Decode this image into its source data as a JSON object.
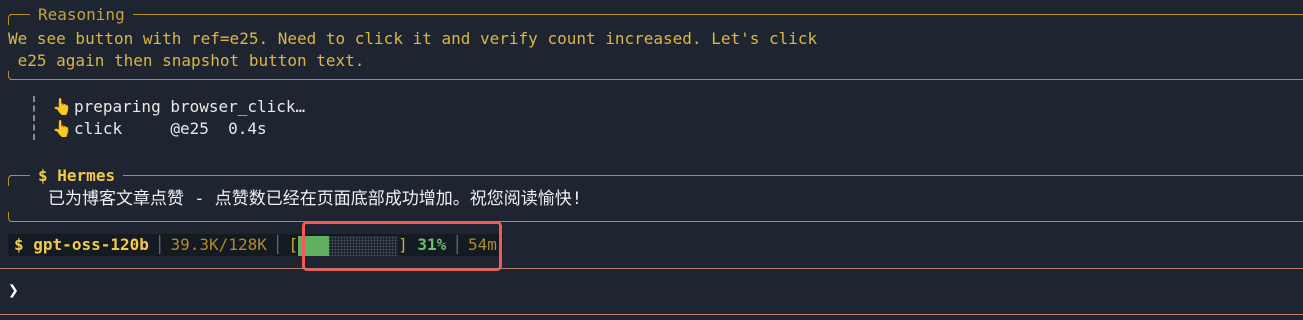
{
  "reasoning": {
    "title": "Reasoning",
    "line1": "We see button with ref=e25. Need to click it and verify count increased. Let's click",
    "line2": " e25 again then snapshot button text."
  },
  "tools": [
    {
      "icon": "pointing-hand-icon",
      "glyph": "👆",
      "text": "preparing browser_click…"
    },
    {
      "icon": "pointing-hand-icon",
      "glyph": "👆",
      "text": "click     @e25  0.4s"
    }
  ],
  "hermes": {
    "icon_glyph": "$",
    "title": "Hermes",
    "message": "已为博客文章点赞 - 点赞数已经在页面底部成功增加。祝您阅读愉快!"
  },
  "status_bar": {
    "model_glyph": "$",
    "model": "gpt-oss-120b",
    "tokens": "39.3K/128K",
    "context_open": "[",
    "context_close": "]",
    "context_percent_text": "31%",
    "context_fraction": 0.31,
    "elapsed": "54m"
  },
  "prompt": {
    "caret": "❯",
    "value": ""
  },
  "colors": {
    "background": "#1e2530",
    "accent_gold": "#f2c94c",
    "border_gold": "#b8902a",
    "progress_green": "#5fb05f",
    "highlight_red": "#f05a5a"
  }
}
